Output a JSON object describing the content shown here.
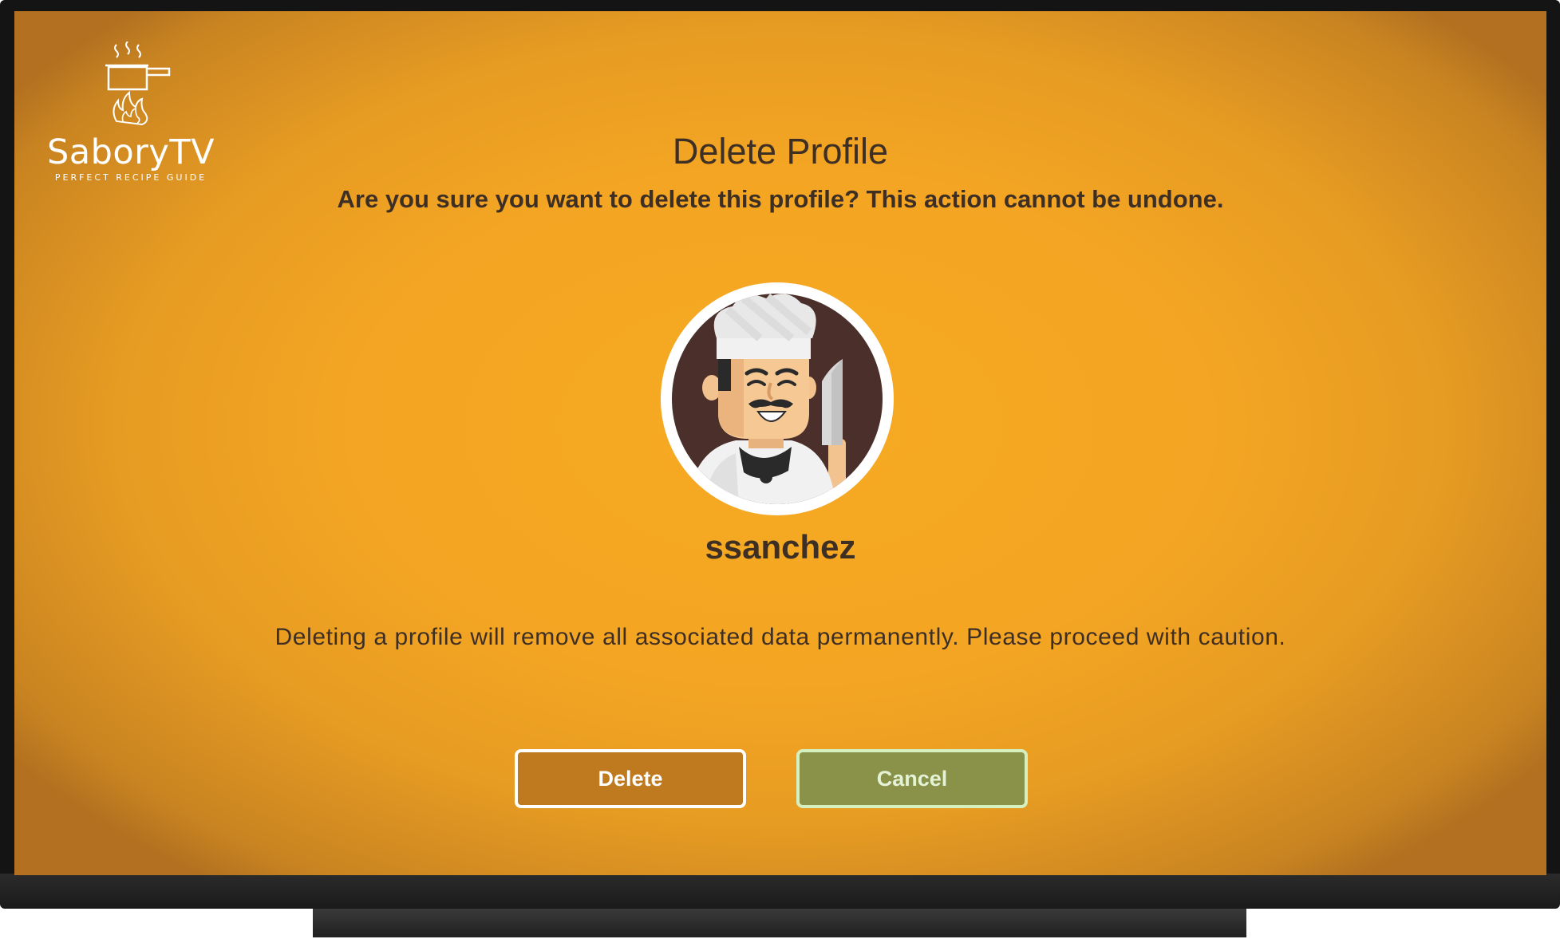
{
  "app": {
    "name": "SaboryTV",
    "tagline": "PERFECT RECIPE GUIDE"
  },
  "dialog": {
    "title": "Delete Profile",
    "subtitle": "Are you sure you want to delete this profile? This action cannot be undone.",
    "warning": "Deleting a profile will remove all associated data permanently. Please proceed with caution."
  },
  "profile": {
    "username": "ssanchez",
    "avatar_icon": "chef-avatar-icon"
  },
  "buttons": {
    "delete_label": "Delete",
    "cancel_label": "Cancel"
  },
  "colors": {
    "background_accent": "#f4a523",
    "text": "#3e2f25",
    "delete_button": "#bf7a1f",
    "cancel_button": "#8a9249"
  }
}
